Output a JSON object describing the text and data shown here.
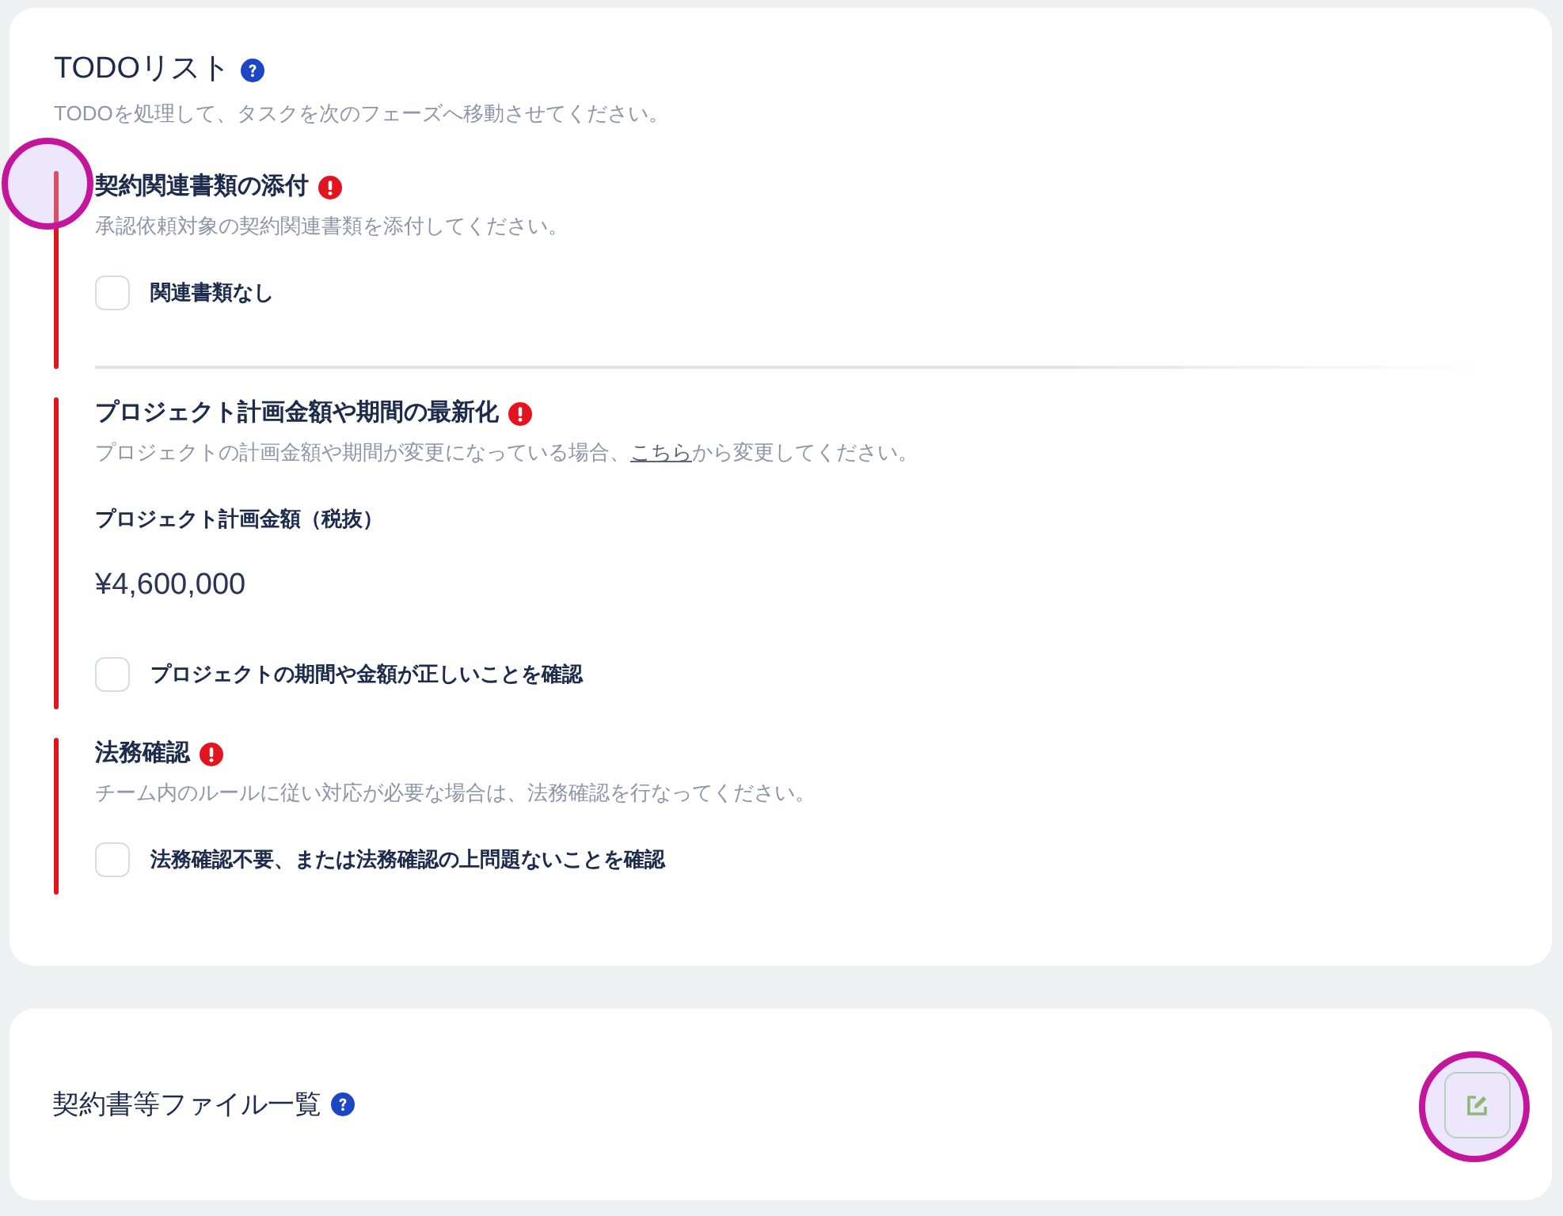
{
  "todo_card": {
    "title": "TODOリスト",
    "subtitle": "TODOを処理して、タスクを次のフェーズへ移動させてください。",
    "tasks": [
      {
        "title": "契約関連書類の添付",
        "description": [
          {
            "kind": "text",
            "text": "承認依頼対象の契約関連書類を添付してください。"
          }
        ],
        "checkbox": {
          "label": "関連書類なし",
          "checked": false
        },
        "highlighted": true,
        "divider_after": true
      },
      {
        "title": "プロジェクト計画金額や期間の最新化",
        "description": [
          {
            "kind": "text",
            "text": "プロジェクトの計画金額や期間が変更になっている場合、"
          },
          {
            "kind": "link",
            "text": "こちら"
          },
          {
            "kind": "text",
            "text": "から変更してください。"
          }
        ],
        "field": {
          "label": "プロジェクト計画金額（税抜）",
          "value": "¥4,600,000"
        },
        "checkbox": {
          "label": "プロジェクトの期間や金額が正しいことを確認",
          "checked": false
        },
        "highlighted": false,
        "divider_after": false
      },
      {
        "title": "法務確認",
        "description": [
          {
            "kind": "text",
            "text": "チーム内のルールに従い対応が必要な場合は、法務確認を行なってください。"
          }
        ],
        "checkbox": {
          "label": "法務確認不要、または法務確認の上問題ないことを確認",
          "checked": false
        },
        "highlighted": false,
        "divider_after": false
      }
    ]
  },
  "files_card": {
    "title": "契約書等ファイル一覧",
    "edit_button": {
      "highlighted": true
    }
  }
}
